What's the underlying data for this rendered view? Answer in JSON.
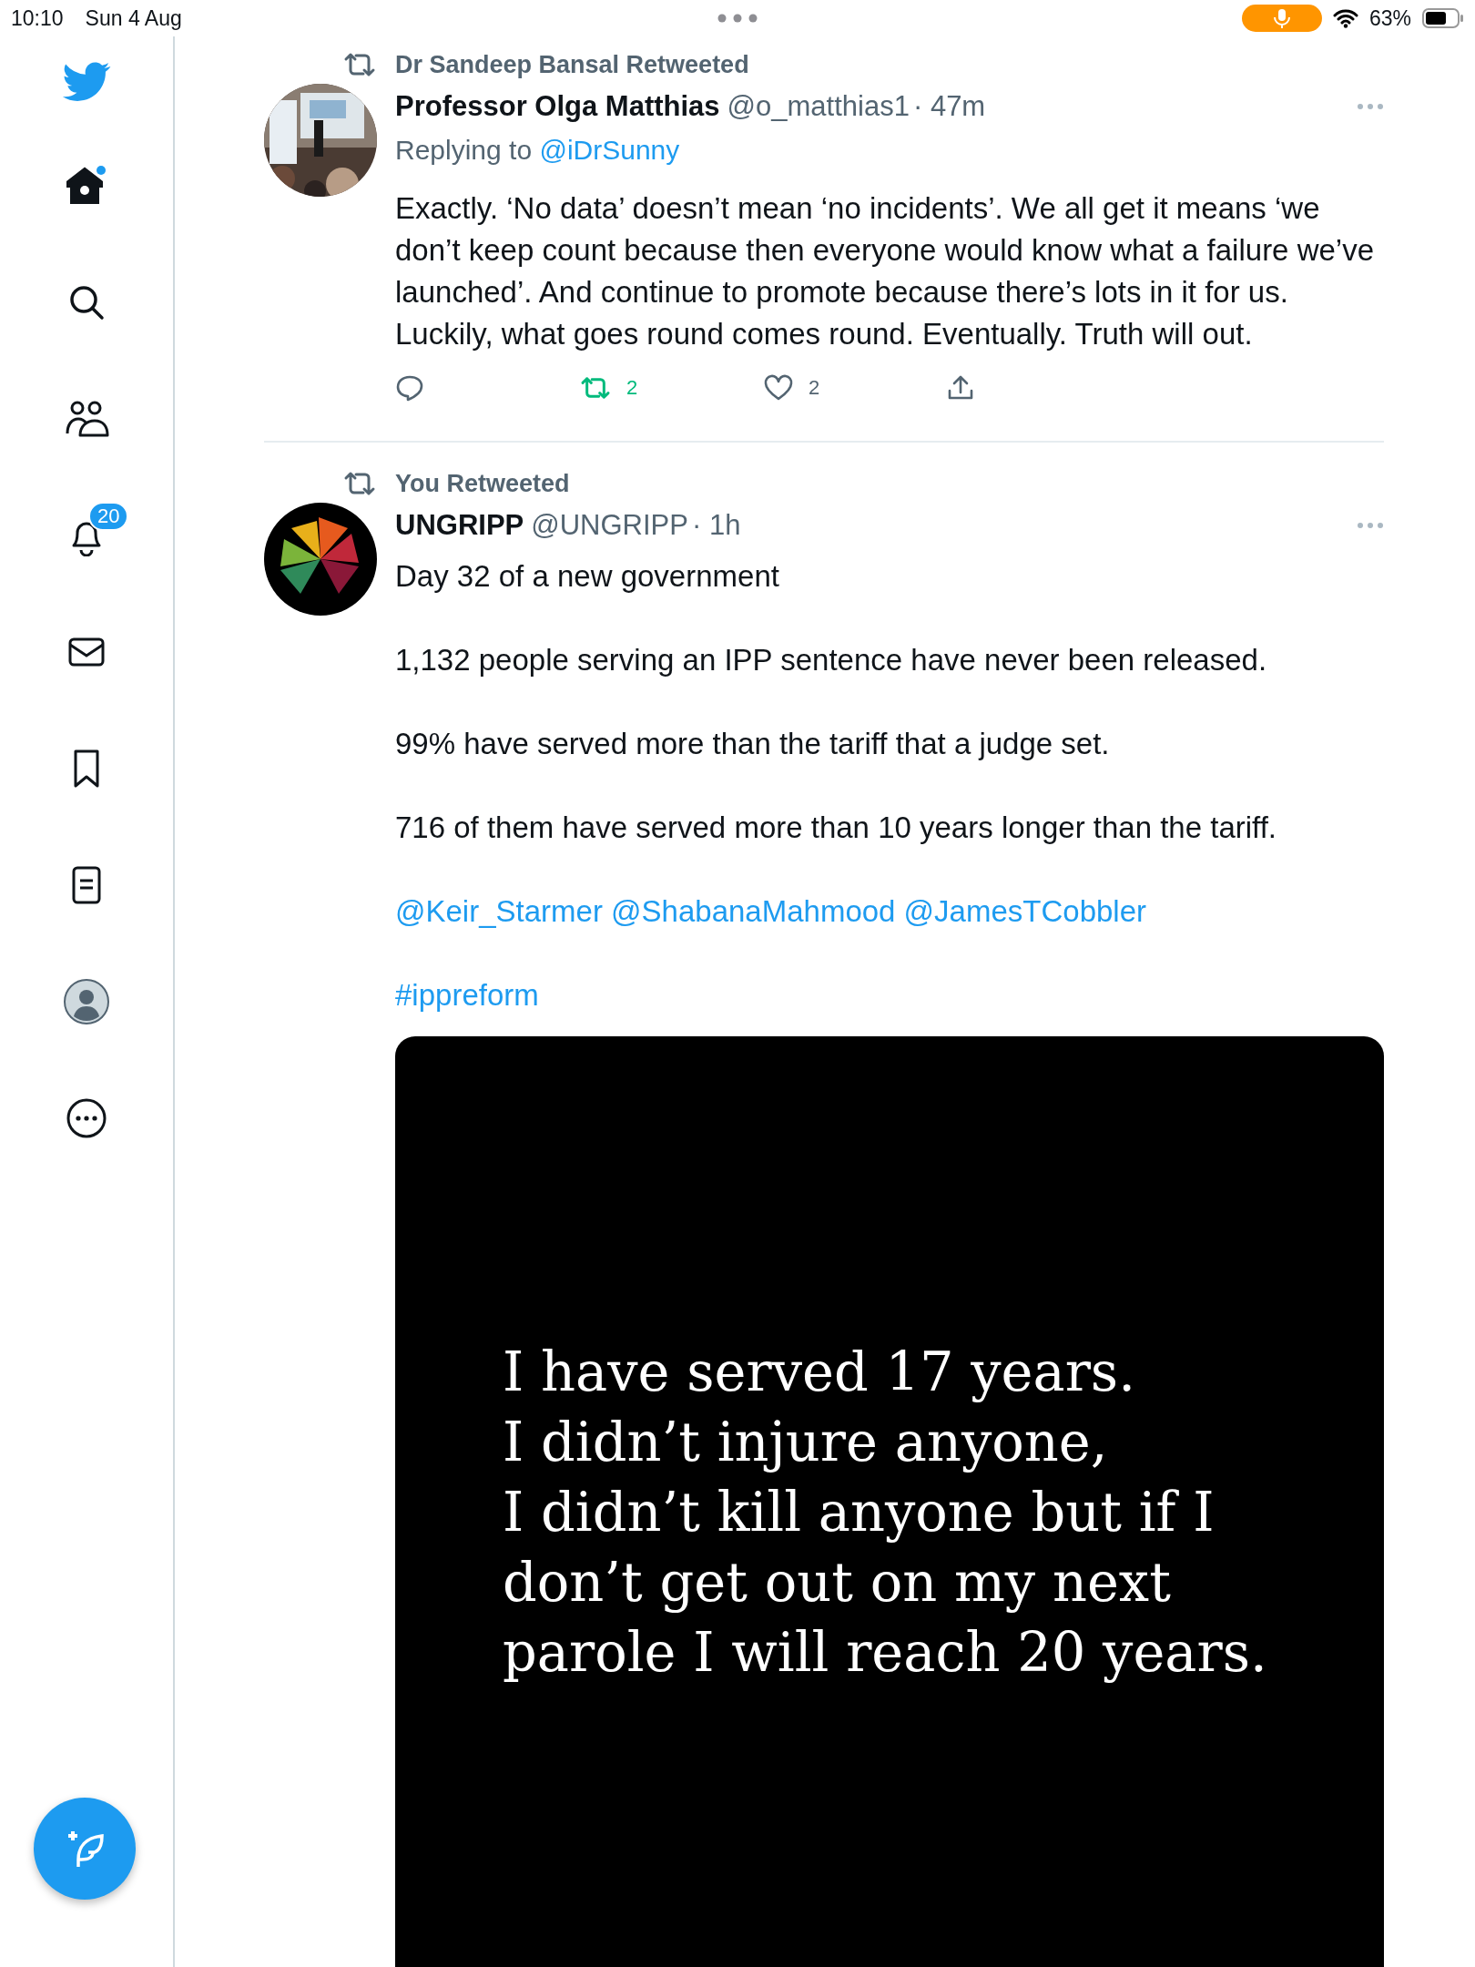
{
  "status_bar": {
    "time": "10:10",
    "date": "Sun 4 Aug",
    "battery": "63%",
    "mic_active": true
  },
  "sidebar": {
    "items": [
      {
        "kind": "home",
        "dot": true,
        "selected": true
      },
      {
        "kind": "search",
        "selected": false
      },
      {
        "kind": "communities",
        "selected": false
      },
      {
        "kind": "notifications",
        "badge": "20",
        "selected": false
      },
      {
        "kind": "messages",
        "selected": false
      },
      {
        "kind": "bookmarks",
        "selected": false
      },
      {
        "kind": "lists",
        "selected": false
      },
      {
        "kind": "profile",
        "selected": false
      },
      {
        "kind": "more",
        "selected": false
      }
    ]
  },
  "tweets": [
    {
      "retweeted_by": "Dr Sandeep Bansal Retweeted",
      "name": "Professor Olga Matthias",
      "handle": "@o_matthias1",
      "time": "· 47m",
      "replying_label": "Replying to",
      "replying_to": "@iDrSunny",
      "avatar": {
        "kind": "picture"
      },
      "paragraphs": [
        {
          "kind": "text",
          "text": "Exactly. ‘No data’ doesn’t mean ‘no incidents’. We all get it means ‘we don’t keep count because then everyone would know what a failure we’ve launched’. And continue to promote because there’s lots in it for us. Luckily, what goes round comes round. Eventually. Truth will out."
        }
      ],
      "actions": {
        "retweets": "2",
        "retweeted": true,
        "likes": "2",
        "liked": false
      }
    },
    {
      "retweeted_by": "You Retweeted",
      "name": "UNGRIPP",
      "handle": "@UNGRIPP",
      "time": "· 1h",
      "avatar": {
        "kind": "picture"
      },
      "paragraphs": [
        {
          "kind": "text",
          "text": "Day 32 of a new government"
        },
        {
          "kind": "text",
          "text": "1,132 people serving an IPP sentence have never been released."
        },
        {
          "kind": "text",
          "text": "99% have served more than the tariff that a judge set."
        },
        {
          "kind": "text",
          "text": "716 of them have served more than 10 years longer than the tariff."
        },
        {
          "kind": "links",
          "links": [
            "@Keir_Starmer",
            "@ShabanaMahmood",
            "@JamesTCobbler"
          ]
        },
        {
          "kind": "links",
          "links": [
            "#ippreform"
          ]
        }
      ],
      "media": {
        "lines": [
          "I have served 17 years.",
          "I didn’t injure anyone,",
          "I didn’t kill anyone but if I",
          "don’t get out on my next",
          "parole I will reach 20 years."
        ]
      }
    }
  ]
}
